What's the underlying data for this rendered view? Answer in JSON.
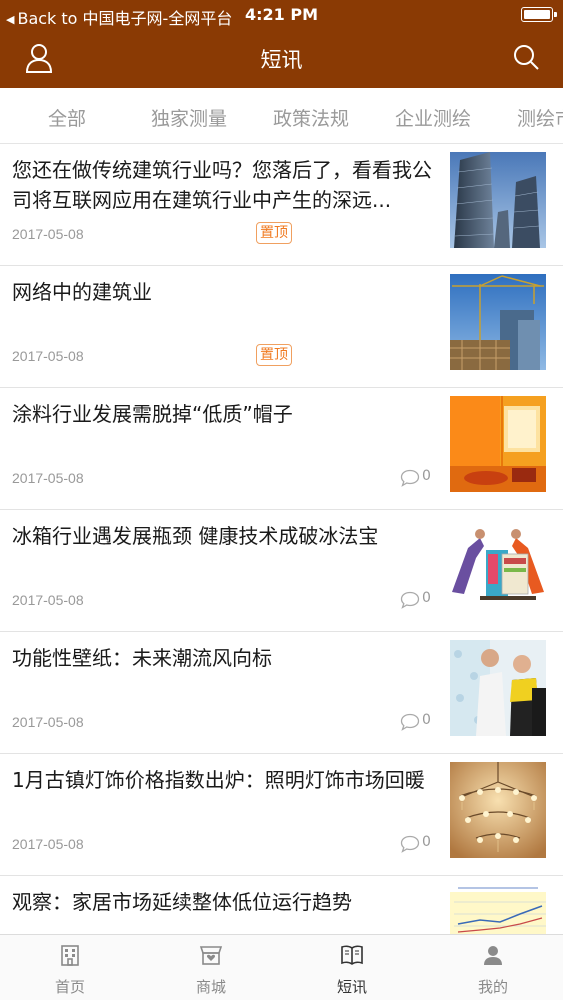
{
  "status_bar": {
    "back_label": "Back to 中国电子网-全网平台",
    "time": "4:21 PM"
  },
  "nav": {
    "title": "短讯",
    "left_icon": "user-icon",
    "right_icon": "search-icon"
  },
  "category_tabs": [
    "全部",
    "独家测量",
    "政策法规",
    "企业测绘",
    "测绘市"
  ],
  "articles": [
    {
      "title": "您还在做传统建筑行业吗？您落后了，看看我公司将互联网应用在建筑行业中产生的深远...",
      "date": "2017-05-08",
      "badge": "置顶",
      "comments": ""
    },
    {
      "title": "网络中的建筑业",
      "date": "2017-05-08",
      "badge": "置顶",
      "comments": ""
    },
    {
      "title": "涂料行业发展需脱掉“低质”帽子",
      "date": "2017-05-08",
      "badge": "",
      "comments": "0"
    },
    {
      "title": "冰箱行业遇发展瓶颈 健康技术成破冰法宝",
      "date": "2017-05-08",
      "badge": "",
      "comments": "0"
    },
    {
      "title": "功能性壁纸：未来潮流风向标",
      "date": "2017-05-08",
      "badge": "",
      "comments": "0"
    },
    {
      "title": "1月古镇灯饰价格指数出炉：照明灯饰市场回暖",
      "date": "2017-05-08",
      "badge": "",
      "comments": "0"
    },
    {
      "title": "观察：家居市场延续整体低位运行趋势",
      "date": "",
      "badge": "",
      "comments": ""
    }
  ],
  "bottom_tabs": [
    {
      "label": "首页",
      "icon": "building-icon"
    },
    {
      "label": "商城",
      "icon": "shop-icon"
    },
    {
      "label": "短讯",
      "icon": "book-icon"
    },
    {
      "label": "我的",
      "icon": "person-icon"
    }
  ],
  "active_bottom_tab": "短讯",
  "colors": {
    "header_bg": "#8a3a04",
    "badge": "#f07a20",
    "muted_text": "#999999",
    "tab_text": "#9a9a9a"
  }
}
